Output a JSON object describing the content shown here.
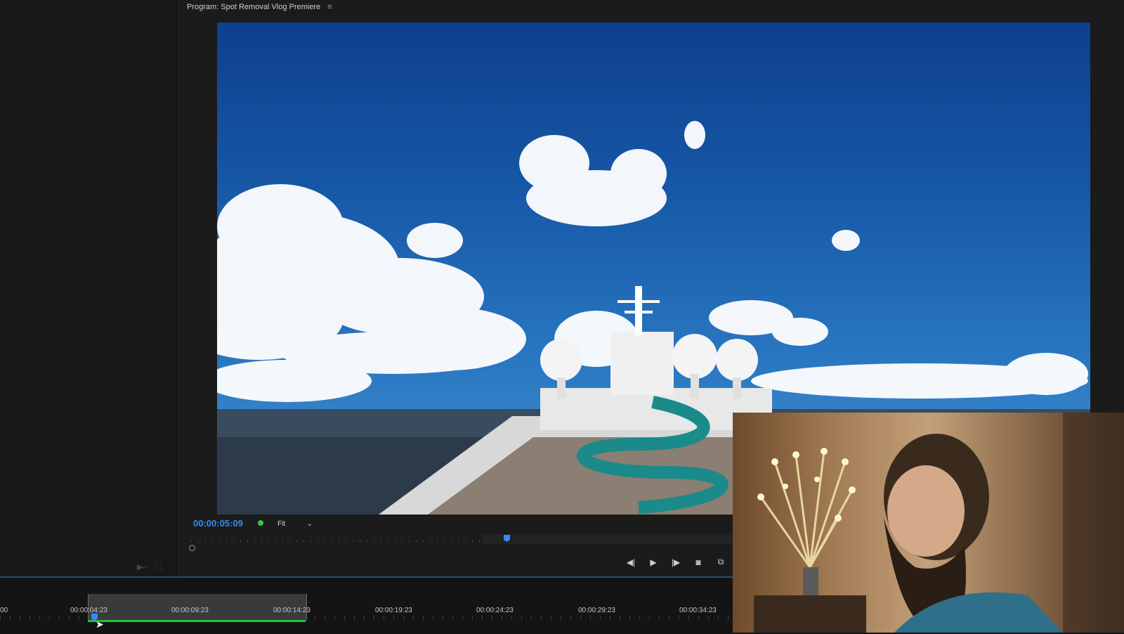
{
  "program_panel": {
    "title": "Program: Spot Removal Vlog Premiere",
    "menu_icon": "hamburger-icon"
  },
  "monitor": {
    "timecode": "00:00:05:09",
    "fit_value": "Fit",
    "status_color": "#2ecc40",
    "accent_color": "#2e8ef7"
  },
  "transport": {
    "step_back_icon": "step-back-icon",
    "play_icon": "play-icon",
    "step_forward_icon": "step-forward-icon",
    "camera_icon": "export-frame-icon",
    "overlay_icon": "compare-view-icon"
  },
  "timeline": {
    "start_label": "00",
    "labels": [
      "00:00:04:23",
      "00:00:09:23",
      "00:00:14:23",
      "00:00:19:23",
      "00:00:24:23",
      "00:00:29:23",
      "00:00:34:23"
    ]
  },
  "video": {
    "subject": "cruise-ship-deck-sky",
    "webcam": "presenter-webcam"
  }
}
